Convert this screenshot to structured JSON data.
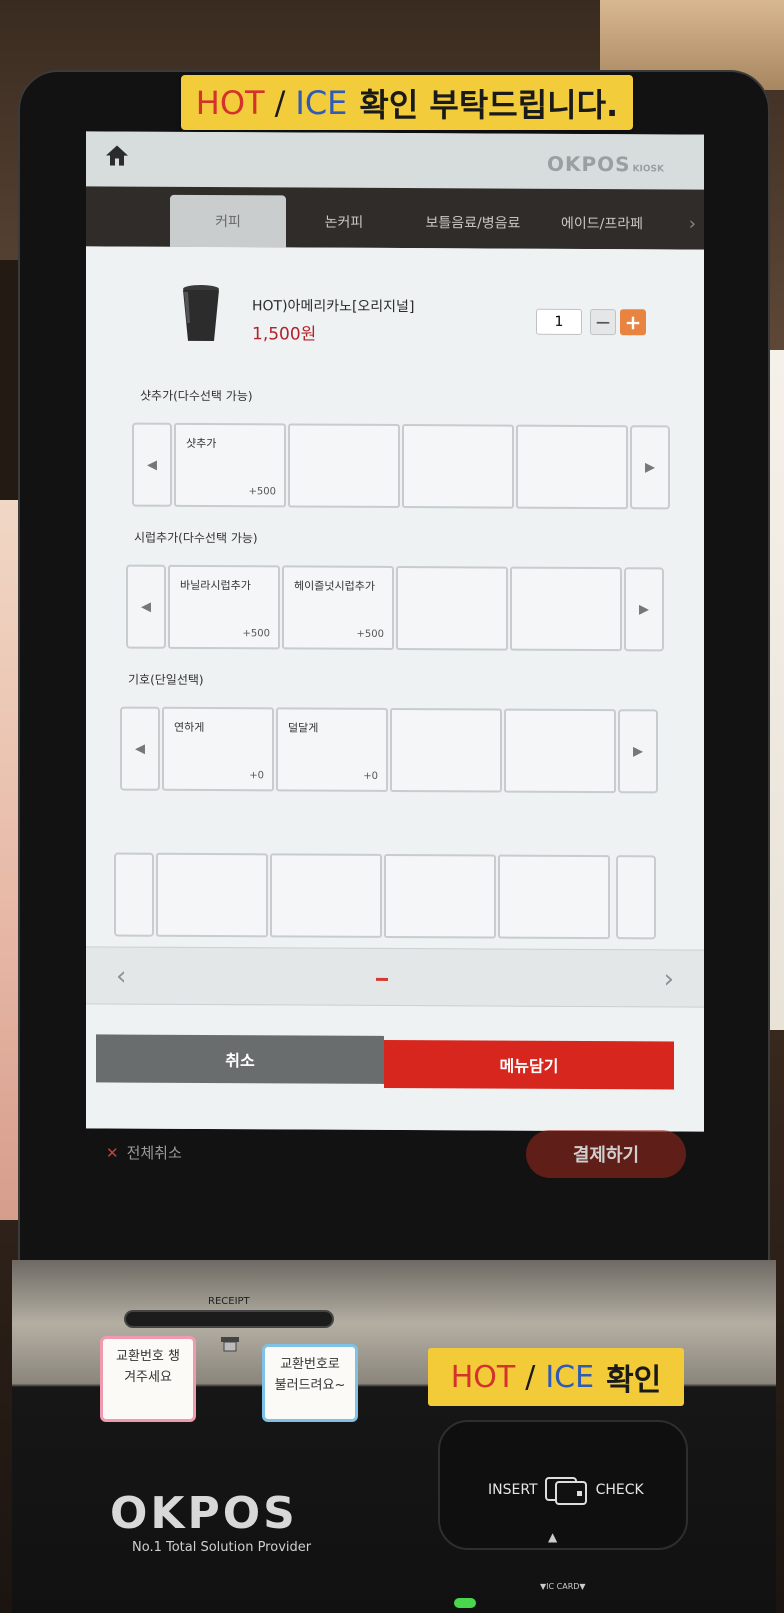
{
  "sticker_top": {
    "hot": "HOT",
    "slash": "/",
    "ice": "ICE",
    "korean": "확인 부탁드립니다."
  },
  "header": {
    "brand": "OKPOS",
    "brand_sub": "KIOSK"
  },
  "tabs": [
    {
      "label": "커피",
      "active": true
    },
    {
      "label": "논커피",
      "active": false
    },
    {
      "label": "보틀음료/병음료",
      "active": false
    },
    {
      "label": "에이드/프라페",
      "active": false
    }
  ],
  "product": {
    "name": "HOT)아메리카노[오리지널]",
    "price": "1,500원",
    "quantity": "1",
    "minus": "−",
    "plus": "+"
  },
  "sections": [
    {
      "title": "샷추가(다수선택 가능)",
      "options": [
        {
          "name": "샷추가",
          "price": "+500"
        }
      ]
    },
    {
      "title": "시럽추가(다수선택 가능)",
      "options": [
        {
          "name": "바닐라시럽추가",
          "price": "+500"
        },
        {
          "name": "헤이즐넛시럽추가",
          "price": "+500"
        }
      ]
    },
    {
      "title": "기호(단일선택)",
      "options": [
        {
          "name": "연하게",
          "price": "+0"
        },
        {
          "name": "덜달게",
          "price": "+0"
        }
      ]
    }
  ],
  "pager": {
    "prev": "‹",
    "next": "›"
  },
  "actions": {
    "cancel": "취소",
    "add_to_cart": "메뉴담기"
  },
  "footer": {
    "cancel_all_icon": "close-icon",
    "cancel_all": "전체취소",
    "pay": "결제하기"
  },
  "hardware": {
    "receipt_label": "RECEIPT",
    "note_left": "교환번호 챙겨주세요",
    "note_right": "교환번호로 불러드려요~",
    "sticker_bottom": {
      "hot": "HOT",
      "slash": "/",
      "ice": "ICE",
      "korean": "확인"
    },
    "insert": "INSERT",
    "check": "CHECK",
    "ic_card": "▼IC CARD▼",
    "brand": "OKPOS",
    "tagline": "No.1 Total Solution Provider"
  },
  "colors": {
    "accent_red": "#d6261d",
    "plus_orange": "#e8843f",
    "sticker_yellow": "#f2cc3a"
  }
}
